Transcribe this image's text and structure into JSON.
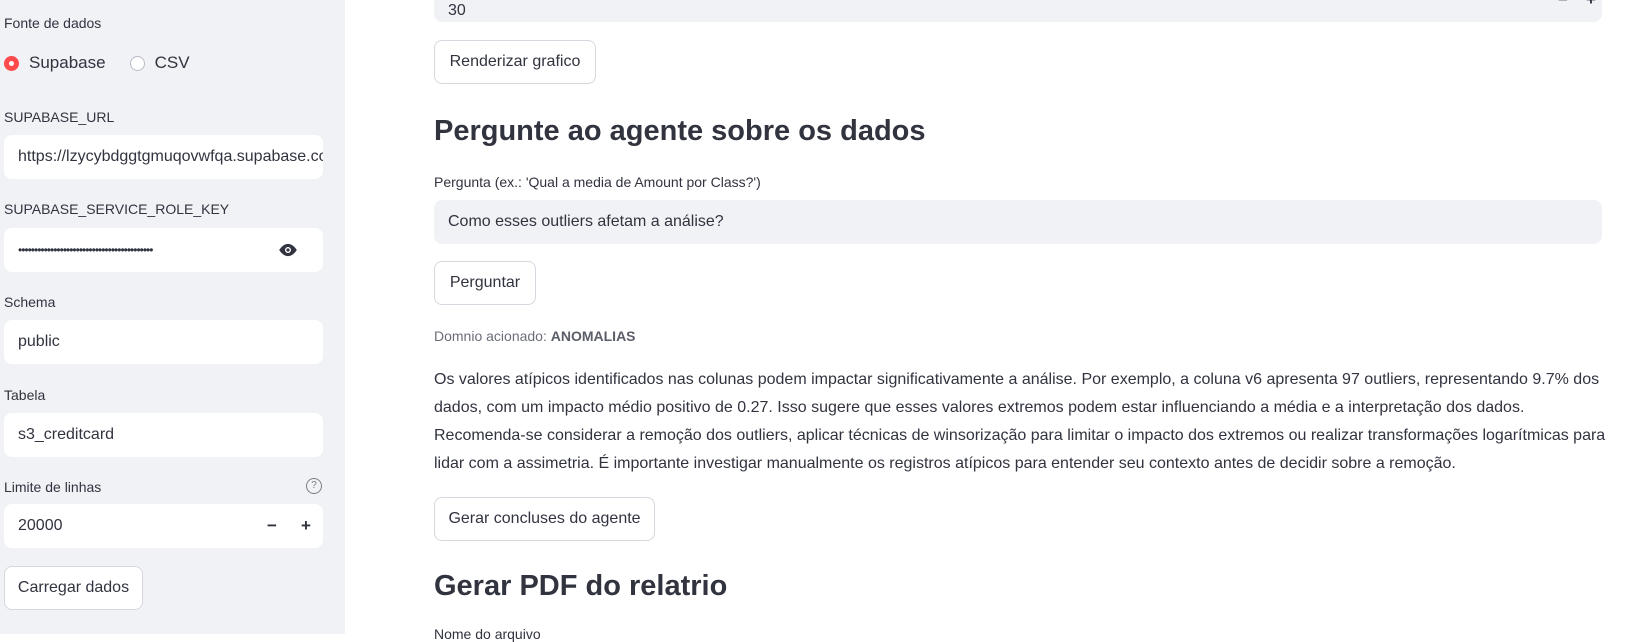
{
  "sidebar": {
    "source_label": "Fonte de dados",
    "options": [
      "Supabase",
      "CSV"
    ],
    "url_label": "SUPABASE_URL",
    "url_value": "https://lzycybdggtgmuqovwfqa.supabase.co",
    "key_label": "SUPABASE_SERVICE_ROLE_KEY",
    "key_value": "••••••••••••••••••••••••••••••••••••••••••",
    "schema_label": "Schema",
    "schema_value": "public",
    "table_label": "Tabela",
    "table_value": "s3_creditcard",
    "limit_label": "Limite de linhas",
    "limit_help": "?",
    "limit_value": "20000",
    "minus": "−",
    "plus": "+",
    "load_button": "Carregar dados"
  },
  "main": {
    "top_value": "30",
    "render_button": "Renderizar grafico",
    "ask_heading": "Pergunte ao agente sobre os dados",
    "question_label": "Pergunta (ex.: 'Qual a media de Amount por Class?')",
    "question_value": "Como esses outliers afetam a análise?",
    "ask_button": "Perguntar",
    "domain_prefix": "Domnio acionado: ",
    "domain_value": "ANOMALIAS",
    "answer": "Os valores atípicos identificados nas colunas podem impactar significativamente a análise. Por exemplo, a coluna v6 apresenta 97 outliers, representando 9.7% dos dados, com um impacto médio positivo de 0.27. Isso sugere que esses valores extremos podem estar influenciando a média e a interpretação dos dados. Recomenda-se considerar a remoção dos outliers, aplicar técnicas de winsorização para limitar o impacto dos extremos ou realizar transformações logarítmicas para lidar com a assimetria. É importante investigar manualmente os registros atípicos para entender seu contexto antes de decidir sobre a remoção.",
    "conclusions_button": "Gerar concluses do agente",
    "pdf_heading": "Gerar PDF do relatrio",
    "cut_label": "Nome do arquivo"
  },
  "colors": {
    "accent": "#ff4b4b",
    "sidebar_bg": "#f0f2f6",
    "text": "#31333f"
  }
}
